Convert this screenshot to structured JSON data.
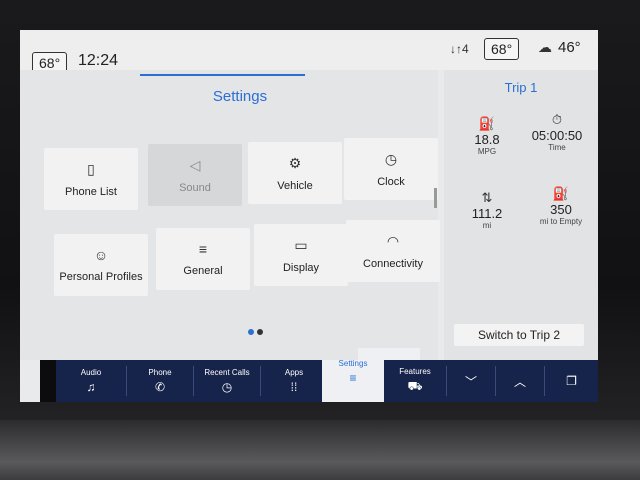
{
  "status_bar": {
    "left_temp": "68°",
    "time": "12:24",
    "signal_icon": "signal-icon",
    "right_temp": "68°",
    "outside_temp": "46°",
    "weather_icon": "cloud-sun-icon"
  },
  "settings": {
    "title": "Settings",
    "tiles": [
      {
        "label": "Phone List",
        "icon": "phone-list-icon",
        "glyph": "▯"
      },
      {
        "label": "Sound",
        "icon": "speaker-icon",
        "glyph": "◁"
      },
      {
        "label": "Vehicle",
        "icon": "vehicle-icon",
        "glyph": "⚙"
      },
      {
        "label": "Clock",
        "icon": "clock-icon",
        "glyph": "◷"
      },
      {
        "label": "Personal Profiles",
        "icon": "profiles-icon",
        "glyph": "☺"
      },
      {
        "label": "General",
        "icon": "sliders-icon",
        "glyph": "≡"
      },
      {
        "label": "Display",
        "icon": "display-icon",
        "glyph": "▭"
      },
      {
        "label": "Connectivity",
        "icon": "wifi-icon",
        "glyph": "◠"
      }
    ],
    "page_dots": {
      "active": "#2a6ed6",
      "inactive": "#333333"
    }
  },
  "trip": {
    "title": "Trip 1",
    "stats": [
      {
        "value": "18.8",
        "unit": "MPG",
        "icon": "fuel-efficiency-icon",
        "glyph": "⛽"
      },
      {
        "value": "05:00:50",
        "unit": "Time",
        "icon": "stopwatch-icon",
        "glyph": "⏱"
      },
      {
        "value": "111.2",
        "unit": "mi",
        "icon": "distance-icon",
        "glyph": "⇅"
      },
      {
        "value": "350",
        "unit": "mi to Empty",
        "icon": "fuel-pump-icon",
        "glyph": "⛽"
      }
    ],
    "switch_label": "Switch to Trip 2"
  },
  "nav": {
    "items": [
      {
        "label": "Audio",
        "icon": "music-note-icon",
        "glyph": "♫"
      },
      {
        "label": "Phone",
        "icon": "phone-icon",
        "glyph": "✆"
      },
      {
        "label": "Recent Calls",
        "icon": "recent-calls-icon",
        "glyph": "◷"
      },
      {
        "label": "Apps",
        "icon": "apps-grid-icon",
        "glyph": "⁞⁞"
      },
      {
        "label": "Settings",
        "icon": "settings-sliders-icon",
        "glyph": "≡"
      },
      {
        "label": "Features",
        "icon": "truck-icon",
        "glyph": "⛟"
      },
      {
        "label": "",
        "icon": "chevron-down-icon",
        "glyph": "﹀"
      },
      {
        "label": "",
        "icon": "chevron-up-icon",
        "glyph": "︿"
      },
      {
        "label": "",
        "icon": "copy-windows-icon",
        "glyph": "❐"
      }
    ]
  },
  "colors": {
    "accent": "#2a6ed6",
    "nav_bg": "#16234a"
  }
}
